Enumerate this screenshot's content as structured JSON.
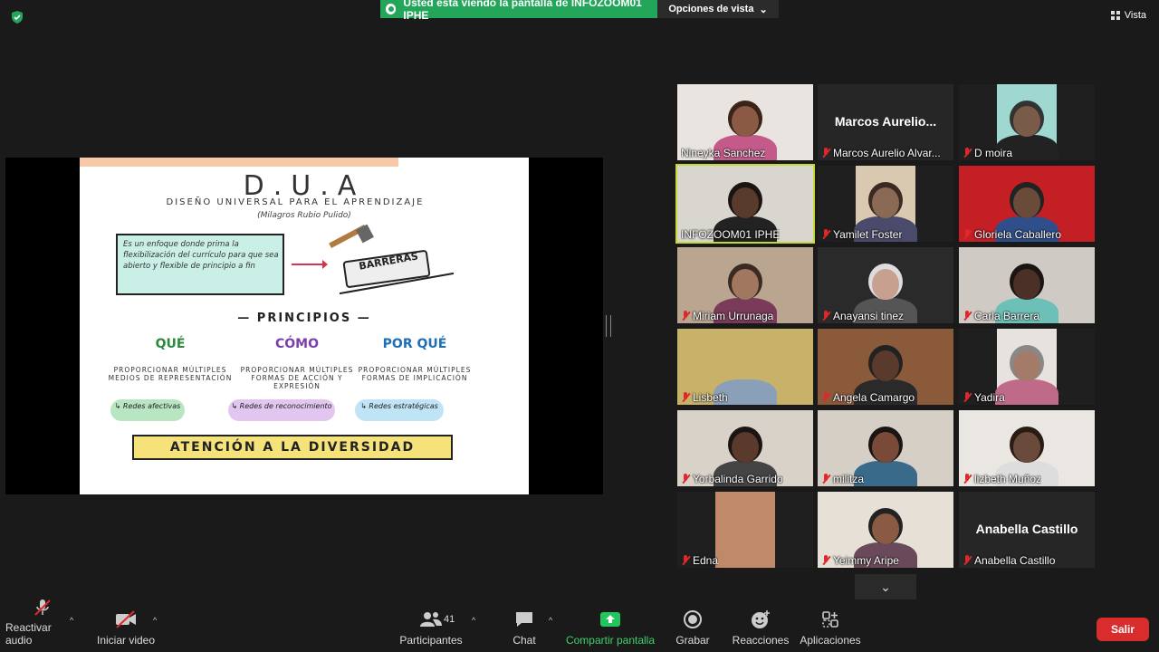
{
  "topbar": {
    "banner_text": "Usted está viendo la pantalla de INFOZOOM01 IPHE",
    "view_options": "Opciones de vista",
    "view_label": "Vista",
    "banner_color": "#23a55a"
  },
  "slide": {
    "title": "D.U.A",
    "subtitle": "DISEÑO UNIVERSAL PARA EL APRENDIZAJE",
    "author": "(Milagros Rubio Pulido)",
    "definition": "Es un enfoque donde prima la flexibilización del currículo para que sea abierto y flexible de principio a fin",
    "barrier": "BARRERAS",
    "principles_title": "— PRINCIPIOS —",
    "columns": [
      {
        "heading": "QUÉ",
        "body": "PROPORCIONAR MÚLTIPLES MEDIOS DE REPRESENTACIÓN",
        "tag": "↳ Redes afectivas"
      },
      {
        "heading": "CÓMO",
        "body": "PROPORCIONAR MÚLTIPLES FORMAS DE ACCIÓN Y EXPRESIÓN",
        "tag": "↳ Redes de reconocimiento"
      },
      {
        "heading": "POR QUÉ",
        "body": "PROPORCIONAR MÚLTIPLES FORMAS DE IMPLICACIÓN",
        "tag": "↳ Redes estratégicas"
      }
    ],
    "footer": "ATENCIÓN A LA DIVERSIDAD"
  },
  "participants": [
    {
      "name": "Nineyka Sanchez",
      "muted": false
    },
    {
      "name": "Marcos Aurelio Alvar...",
      "muted": true,
      "big_name": "Marcos Aurelio..."
    },
    {
      "name": "D moira",
      "muted": true
    },
    {
      "name": "INFOZOOM01 IPHE",
      "muted": false,
      "active": true
    },
    {
      "name": "Yamilet Foster",
      "muted": true
    },
    {
      "name": "Gloriela Caballero",
      "muted": true
    },
    {
      "name": "Miriam Urrunaga",
      "muted": true
    },
    {
      "name": "Anayansi tinez",
      "muted": true
    },
    {
      "name": "Carla Barrera",
      "muted": true
    },
    {
      "name": "Lisbeth",
      "muted": true
    },
    {
      "name": "Angela Camargo",
      "muted": true
    },
    {
      "name": "Yadira",
      "muted": true
    },
    {
      "name": "Yorbalinda Garrido",
      "muted": true
    },
    {
      "name": "militza",
      "muted": true
    },
    {
      "name": "lizbeth Muñoz",
      "muted": true
    },
    {
      "name": "Edna",
      "muted": true
    },
    {
      "name": "Yeimmy Aripe",
      "muted": true
    },
    {
      "name": "Anabella Castillo",
      "muted": true,
      "big_name": "Anabella Castillo"
    }
  ],
  "toolbar": {
    "audio": "Reactivar audio",
    "video": "Iniciar video",
    "participants": "Participantes",
    "participant_count": "41",
    "chat": "Chat",
    "share": "Compartir pantalla",
    "record": "Grabar",
    "reactions": "Reacciones",
    "apps": "Aplicaciones",
    "leave": "Salir"
  }
}
